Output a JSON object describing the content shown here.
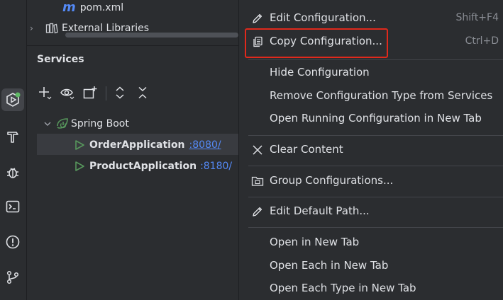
{
  "project_tree": {
    "pom_file": "pom.xml",
    "pom_icon_glyph": "m",
    "external_libraries": "External Libraries"
  },
  "services": {
    "title": "Services",
    "group": "Spring Boot",
    "apps": [
      {
        "name": "OrderApplication",
        "port": ":8080/"
      },
      {
        "name": "ProductApplication",
        "port": ":8180/"
      }
    ]
  },
  "menu": {
    "edit_configuration": {
      "label": "Edit Configuration...",
      "shortcut": "Shift+F4"
    },
    "copy_configuration": {
      "label": "Copy Configuration...",
      "shortcut": "Ctrl+D"
    },
    "hide_configuration": {
      "label": "Hide Configuration"
    },
    "remove_configuration_type": {
      "label": "Remove Configuration Type from Services"
    },
    "open_running_configuration": {
      "label": "Open Running Configuration in New Tab"
    },
    "clear_content": {
      "label": "Clear Content"
    },
    "group_configurations": {
      "label": "Group Configurations..."
    },
    "edit_default_path": {
      "label": "Edit Default Path..."
    },
    "open_in_new_tab": {
      "label": "Open in New Tab"
    },
    "open_each_in_new_tab": {
      "label": "Open Each in New Tab"
    },
    "open_each_type_in_new_tab": {
      "label": "Open Each Type in New Tab"
    }
  },
  "colors": {
    "background": "#2b2d30",
    "selection": "#393b40",
    "link": "#548af7",
    "run_green": "#57965c",
    "highlight_red": "#e0291c",
    "badge_green": "#5fb865"
  }
}
